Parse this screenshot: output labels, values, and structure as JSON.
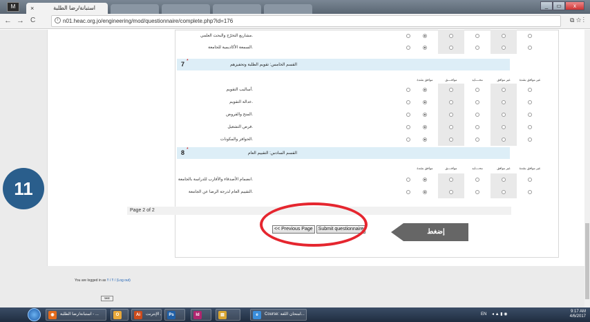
{
  "browser": {
    "tab_title": "استبانة/رضا الطلبة",
    "tab_close": "×",
    "logo": "M",
    "url": "n01.heac.org.jo/engineering/mod/questionnaire/complete.php?id=176",
    "url_info": "i",
    "back": "←",
    "forward": "→",
    "reload": "C",
    "right_icons": "⧉ ☆ ⋮",
    "win_min": "_",
    "win_max": "▭",
    "win_close": "x"
  },
  "scale_headers": [
    "غير موافق بشدة",
    "غير موافق",
    "محــــايد",
    "موافــــق",
    "موافق بشدة"
  ],
  "top_rows": [
    {
      "label": ".مشاريع التخرّج والبحث العلمي",
      "selected": 0
    },
    {
      "label": ".السمعة الأكاديمية للجامعة",
      "selected": 0
    }
  ],
  "sections": [
    {
      "number": "7",
      "star": "*",
      "title": "القسم الخامس: تقويم الطلبة وتحفيزهم",
      "rows": [
        {
          "label": ".أساليب التقويم",
          "selected": 0
        },
        {
          "label": ".عدالة التقويم",
          "selected": 0
        },
        {
          "label": ".المنح والقروض",
          "selected": 0
        },
        {
          "label": ".فرص التشغيل",
          "selected": 0
        },
        {
          "label": ".الحوافز والمكونات",
          "selected": 0
        }
      ]
    },
    {
      "number": "8",
      "star": "*",
      "title": "القسم السادس: التقييم العام",
      "rows": [
        {
          "label": ".انضمام الأصدقاء والأقارب للدراسة بالجامعة",
          "selected": 0
        },
        {
          "label": ".التقييم العام لدرجة الرضا عن الجامعة",
          "selected": 0
        }
      ]
    }
  ],
  "page_indicator": "Page 2 of 2",
  "buttons": {
    "previous": "<< Previous Page",
    "submit": "Submit questionnaire"
  },
  "callout": "إضغط",
  "step_badge": "11",
  "login": {
    "prefix": "You are logged in as",
    "user": "!! / !! /",
    "logout": "(Log out)"
  },
  "test_button": "test",
  "taskbar": {
    "items": [
      {
        "label": "استبانة/رضا الطلبة - ...",
        "icon": "◉",
        "color": "#e46b1c"
      },
      {
        "label": "",
        "icon": "O",
        "color": "#e8a83a"
      },
      {
        "label": "آلية الدخول إلى الإنترنت...",
        "icon": "Ai",
        "color": "#cc4b1c"
      },
      {
        "label": "",
        "icon": "Ps",
        "color": "#1f5fa6"
      },
      {
        "label": "",
        "icon": "Id",
        "color": "#b0256f"
      },
      {
        "label": "",
        "icon": "▤",
        "color": "#d8a531"
      },
      {
        "label": "Course: امتحان اللغة...",
        "icon": "e",
        "color": "#3a8edb"
      }
    ],
    "lang": "EN",
    "time": "9:17 AM",
    "date": "4/6/2017"
  },
  "colors": {
    "accent_ring": "#e5262f",
    "section_bar": "#ddeef7",
    "badge": "#2a5e8c"
  }
}
